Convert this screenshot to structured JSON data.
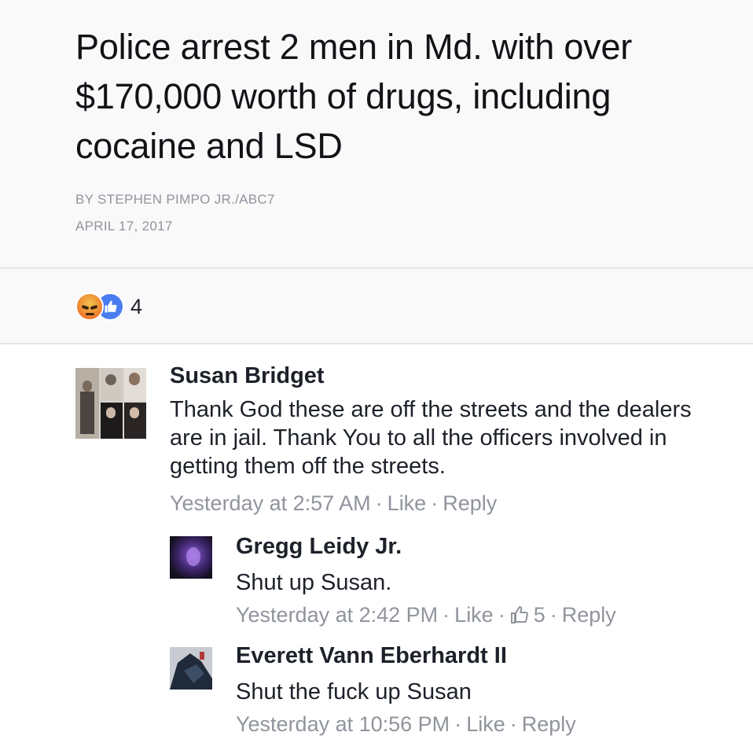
{
  "article": {
    "headline": "Police arrest 2 men in Md. with over $170,000 worth of drugs, including cocaine and LSD",
    "byline": "BY STEPHEN PIMPO JR./ABC7",
    "date": "APRIL 17, 2017"
  },
  "reactions": {
    "icons": [
      "angry-icon",
      "like-icon"
    ],
    "count": "4"
  },
  "comments": [
    {
      "author": "Susan Bridget",
      "text": "Thank God these are off the streets and the dealers are in jail. Thank You to all the officers involved in getting them off the streets.",
      "time": "Yesterday at 2:57 AM",
      "like_label": "Like",
      "reply_label": "Reply"
    },
    {
      "author": "Gregg Leidy Jr.",
      "text": "Shut up Susan.",
      "time": "Yesterday at 2:42 PM",
      "like_label": "Like",
      "like_count": "5",
      "reply_label": "Reply"
    },
    {
      "author": "Everett Vann Eberhardt II",
      "text": "Shut the fuck up Susan",
      "time": "Yesterday at 10:56 PM",
      "like_label": "Like",
      "reply_label": "Reply"
    }
  ],
  "separator": "·",
  "colors": {
    "meta_gray": "#90949c",
    "like_blue": "#4a7ef0",
    "angry_orange": "#ef8b33",
    "text_dark": "#1d2129",
    "card_bg": "#f9f9fa"
  }
}
